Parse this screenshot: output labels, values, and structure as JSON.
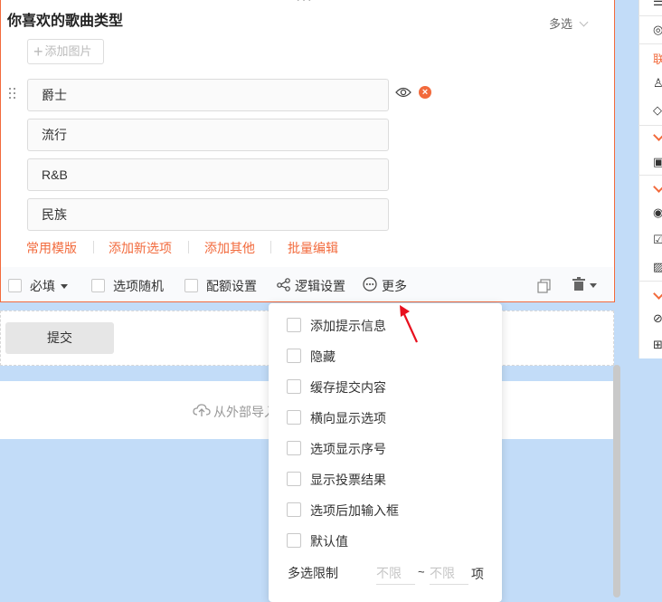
{
  "question": {
    "title": "你喜欢的歌曲类型",
    "type_label": "多选",
    "add_image_label": "添加图片",
    "options": [
      "爵士",
      "流行",
      "R&B",
      "民族"
    ]
  },
  "option_links": [
    "常用模版",
    "添加新选项",
    "添加其他",
    "批量编辑"
  ],
  "toolbar": {
    "required_label": "必填",
    "random_label": "选项随机",
    "quota_label": "配额设置",
    "logic_label": "逻辑设置",
    "more_label": "更多"
  },
  "submit_label": "提交",
  "import_text": "从外部导入",
  "more_menu": {
    "items": [
      "添加提示信息",
      "隐藏",
      "缓存提交内容",
      "横向显示选项",
      "选项显示序号",
      "显示投票结果",
      "选项后加输入框",
      "默认值"
    ],
    "limit_label": "多选限制",
    "min_placeholder": "不限",
    "max_placeholder": "不限",
    "limit_separator": "~",
    "limit_unit": "项"
  },
  "right_panel": {
    "section_label": "联"
  },
  "colors": {
    "accent": "#f26a3c",
    "background": "#c2dcf8"
  }
}
